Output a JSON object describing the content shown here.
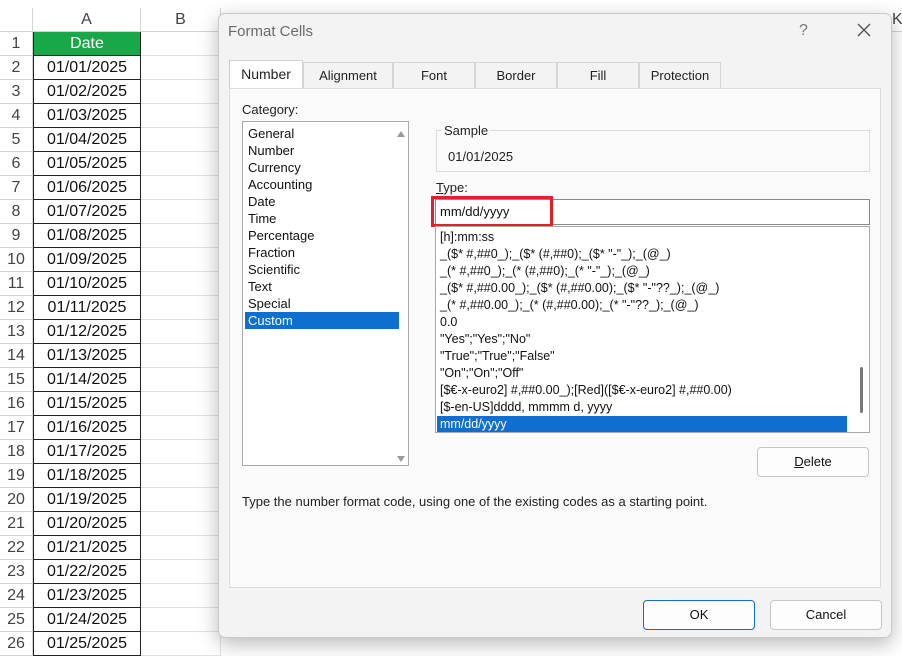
{
  "spreadsheet": {
    "columns": [
      "A",
      "B",
      "K"
    ],
    "header_cell": "Date",
    "row_numbers": [
      "1",
      "2",
      "3",
      "4",
      "5",
      "6",
      "7",
      "8",
      "9",
      "10",
      "11",
      "12",
      "13",
      "14",
      "15",
      "16",
      "17",
      "18",
      "19",
      "20",
      "21",
      "22",
      "23",
      "24",
      "25",
      "26"
    ],
    "dates": [
      "01/01/2025",
      "01/02/2025",
      "01/03/2025",
      "01/04/2025",
      "01/05/2025",
      "01/06/2025",
      "01/07/2025",
      "01/08/2025",
      "01/09/2025",
      "01/10/2025",
      "01/11/2025",
      "01/12/2025",
      "01/13/2025",
      "01/14/2025",
      "01/15/2025",
      "01/16/2025",
      "01/17/2025",
      "01/18/2025",
      "01/19/2025",
      "01/20/2025",
      "01/21/2025",
      "01/22/2025",
      "01/23/2025",
      "01/24/2025",
      "01/25/2025"
    ],
    "header_color": "#18a84a"
  },
  "dialog": {
    "title": "Format Cells",
    "help": "?",
    "tabs": [
      "Number",
      "Alignment",
      "Font",
      "Border",
      "Fill",
      "Protection"
    ],
    "active_tab": "Number",
    "category_label": "Category:",
    "categories": [
      "General",
      "Number",
      "Currency",
      "Accounting",
      "Date",
      "Time",
      "Percentage",
      "Fraction",
      "Scientific",
      "Text",
      "Special",
      "Custom"
    ],
    "selected_category": "Custom",
    "sample_label": "Sample",
    "sample_value": "01/01/2025",
    "type_label": "Type:",
    "type_value": "mm/dd/yyyy",
    "format_codes": [
      "[h]:mm:ss",
      "_($* #,##0_);_($* (#,##0);_($* \"-\"_);_(@_)",
      "_(* #,##0_);_(* (#,##0);_(* \"-\"_);_(@_)",
      "_($* #,##0.00_);_($* (#,##0.00);_($* \"-\"??_);_(@_)",
      "_(* #,##0.00_);_(* (#,##0.00);_(* \"-\"??_);_(@_)",
      "0.0",
      "\"Yes\";\"Yes\";\"No\"",
      "\"True\";\"True\";\"False\"",
      "\"On\";\"On\";\"Off\"",
      "[$€-x-euro2] #,##0.00_);[Red]([$€-x-euro2] #,##0.00)",
      "[$-en-US]dddd, mmmm d, yyyy",
      "mm/dd/yyyy"
    ],
    "selected_format": "mm/dd/yyyy",
    "delete_label": "Delete",
    "hint": "Type the number format code, using one of the existing codes as a starting point.",
    "ok_label": "OK",
    "cancel_label": "Cancel",
    "accent_color": "#0f6fd1",
    "highlight_color": "#e0202a"
  }
}
